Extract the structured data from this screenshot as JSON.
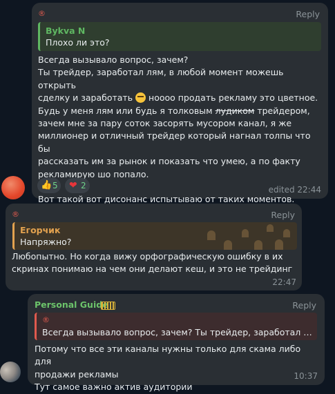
{
  "msg1": {
    "sender_symbol": "®",
    "reply_label": "Reply",
    "quote": {
      "name": "Bykva N",
      "text": "Плохо ли это?",
      "accent": "#5fb762"
    },
    "lines": [
      "Всегда вызывало вопрос, зачем?",
      "Ты трейдер, заработал лям, в любой момент можешь открыть",
      {
        "before": "сделку и заработать ",
        "emoji": "face-emoji",
        "after": " ноооо продать рекламу это цветное."
      },
      {
        "before": "Будь у меня лям или будь я толковым ",
        "strike": "лудиком",
        "after": " трейдером,"
      },
      "зачем мне за пару соток засорять мусором канал, я же",
      "миллионер и отличный трейдер который нагнал толпы что бы",
      "рассказать им за рынок и показать что умею, а по факту",
      "рекламирую шо попало.",
      "",
      "Вот такой вот дисонанс испытываю от таких моментов."
    ],
    "reactions": [
      {
        "icon": "thumbs-up-icon",
        "glyph": "👍",
        "count": "5"
      },
      {
        "icon": "heart-icon",
        "glyph": "❤",
        "count": "2"
      }
    ],
    "time": "edited 22:44"
  },
  "msg2": {
    "sender_symbol": "®",
    "reply_label": "Reply",
    "quote": {
      "name": "Егорчик",
      "text": "Напряжно?",
      "accent": "#e3a24f"
    },
    "lines": [
      "Любопытно. Но когда вижу орфографическую ошибку в их",
      "скринах понимаю на чем они делают кеш, и это не трейдинг"
    ],
    "time": "22:47"
  },
  "msg3": {
    "sender_name": "Personal Guide",
    "sender_color": "#6cc36a",
    "reply_label": "Reply",
    "quote": {
      "symbol": "®",
      "text": "Всегда вызывало вопрос, зачем? Ты трейдер, заработал лям, в любой момент...",
      "accent": "#e05a4e"
    },
    "lines": [
      "Потому что все эти каналы нужны только для скама либо для",
      "продажи рекламы",
      "Тут самое важно актив аудитории"
    ],
    "time": "10:37"
  },
  "colors": {
    "accent_orange": "#e3462a",
    "bubble": "#2a2f34",
    "background": "#0e1621"
  }
}
